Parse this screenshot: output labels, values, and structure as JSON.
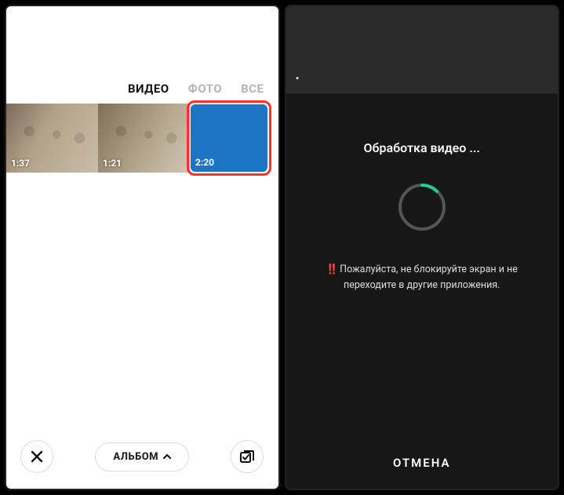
{
  "left": {
    "tabs": {
      "video": "ВИДЕО",
      "photo": "ФОТО",
      "all": "ВСЕ",
      "active": "video"
    },
    "thumbs": [
      {
        "duration": "1:37"
      },
      {
        "duration": "1:21"
      },
      {
        "duration": "2:20",
        "selected": true
      }
    ],
    "album_button": "АЛЬБОМ"
  },
  "right": {
    "processing_title": "Обработка видео ...",
    "warning_emoji": "‼️",
    "warning_text": "Пожалуйста, не блокируйте экран и не переходите в другие приложения.",
    "cancel": "ОТМЕНА",
    "spinner_color": "#1fcf9b"
  }
}
